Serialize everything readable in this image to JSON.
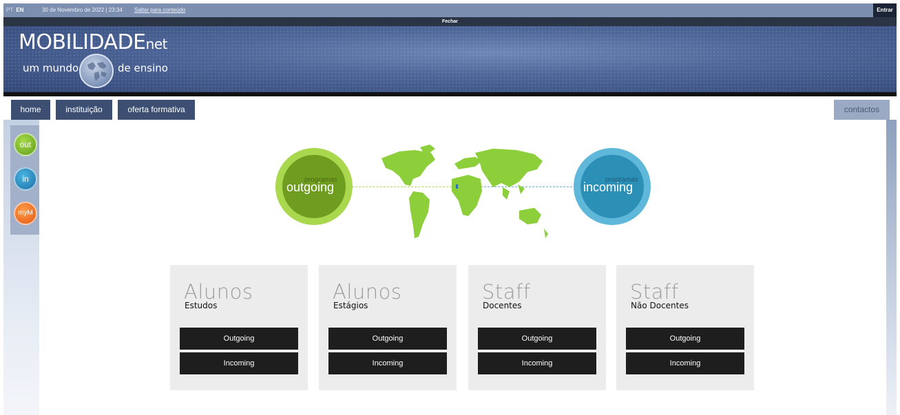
{
  "topbar": {
    "lang_pt": "PT",
    "lang_en": "EN",
    "datetime": "30 de Novembro de 2022 | 23:34",
    "skip_link": "Saltar para conteúdo",
    "login": "Entrar"
  },
  "strip_label": "Fechar",
  "banner": {
    "title_main": "MOBILIDADE",
    "title_suffix": "net",
    "tagline_left": "um mundo",
    "tagline_right": "de ensino"
  },
  "nav": {
    "home": "home",
    "instituicao": "instituição",
    "oferta": "oferta formativa",
    "contactos": "contactos"
  },
  "side_buttons": {
    "out": "out",
    "in": "in",
    "mym": "myM"
  },
  "hero": {
    "out_sub": "programas",
    "out_main": "outgoing",
    "in_sub": "programas",
    "in_main": "incoming"
  },
  "cards": [
    {
      "title": "Alunos",
      "subtitle": "Estudos",
      "btn_out": "Outgoing",
      "btn_in": "Incoming"
    },
    {
      "title": "Alunos",
      "subtitle": "Estágios",
      "btn_out": "Outgoing",
      "btn_in": "Incoming"
    },
    {
      "title": "Staff",
      "subtitle": "Docentes",
      "btn_out": "Outgoing",
      "btn_in": "Incoming"
    },
    {
      "title": "Staff",
      "subtitle": "Não Docentes",
      "btn_out": "Outgoing",
      "btn_in": "Incoming"
    }
  ],
  "colors": {
    "nav_bg": "#3c4f73",
    "outgoing_green": "#6f9d1f",
    "incoming_blue": "#2c8fb6",
    "card_button": "#1e1e1e"
  }
}
